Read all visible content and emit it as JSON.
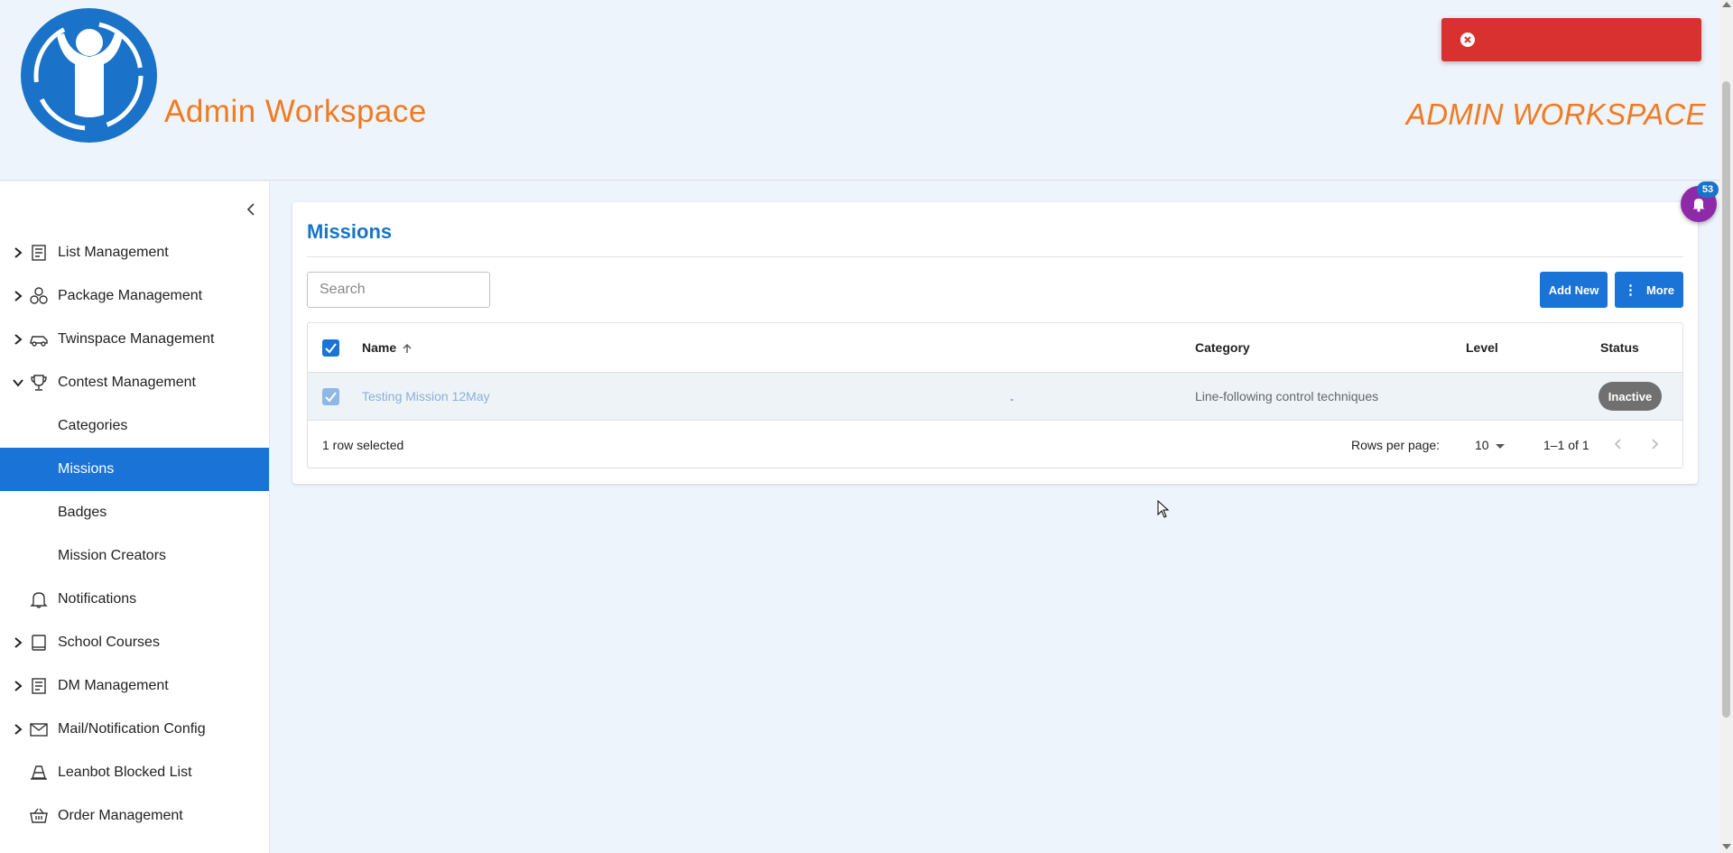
{
  "header": {
    "title": "Admin Workspace",
    "title_right": "ADMIN WORKSPACE",
    "logo_icon": "child-logo-icon",
    "brand_color": "#1a73c8",
    "title_color": "#f07b22"
  },
  "toast": {
    "type": "error",
    "color": "#d93030",
    "message": ""
  },
  "sidebar": {
    "items": [
      {
        "label": "List Management",
        "icon": "document-list-icon",
        "expandable": true
      },
      {
        "label": "Package Management",
        "icon": "boxes-icon",
        "expandable": true
      },
      {
        "label": "Twinspace Management",
        "icon": "car-icon",
        "expandable": true
      },
      {
        "label": "Contest Management",
        "icon": "trophy-icon",
        "expandable": true,
        "expanded": true
      },
      {
        "label": "Categories",
        "child": true
      },
      {
        "label": "Missions",
        "child": true,
        "active": true
      },
      {
        "label": "Badges",
        "child": true
      },
      {
        "label": "Mission Creators",
        "child": true
      },
      {
        "label": "Notifications",
        "icon": "bell-icon",
        "expandable": false
      },
      {
        "label": "School Courses",
        "icon": "book-icon",
        "expandable": true
      },
      {
        "label": "DM Management",
        "icon": "document-list-icon",
        "expandable": true
      },
      {
        "label": "Mail/Notification Config",
        "icon": "mail-icon",
        "expandable": true
      },
      {
        "label": "Leanbot Blocked List",
        "icon": "cone-icon",
        "expandable": false
      },
      {
        "label": "Order Management",
        "icon": "basket-icon",
        "expandable": false
      }
    ]
  },
  "missions": {
    "title": "Missions",
    "search_placeholder": "Search",
    "add_new_label": "Add New",
    "more_label": "More",
    "columns": {
      "name": "Name",
      "category": "Category",
      "level": "Level",
      "status": "Status"
    },
    "rows": [
      {
        "name": "Testing Mission 12May",
        "extra": "-",
        "category": "Line-following control techniques",
        "level": "",
        "status": "Inactive",
        "selected": true
      }
    ],
    "footer": {
      "selected_text": "1 row selected",
      "rows_per_page_label": "Rows per page:",
      "rows_per_page_value": "10",
      "range_text": "1–1 of 1"
    }
  },
  "notifications_fab": {
    "count": "53",
    "color": "#8e2aa8"
  }
}
